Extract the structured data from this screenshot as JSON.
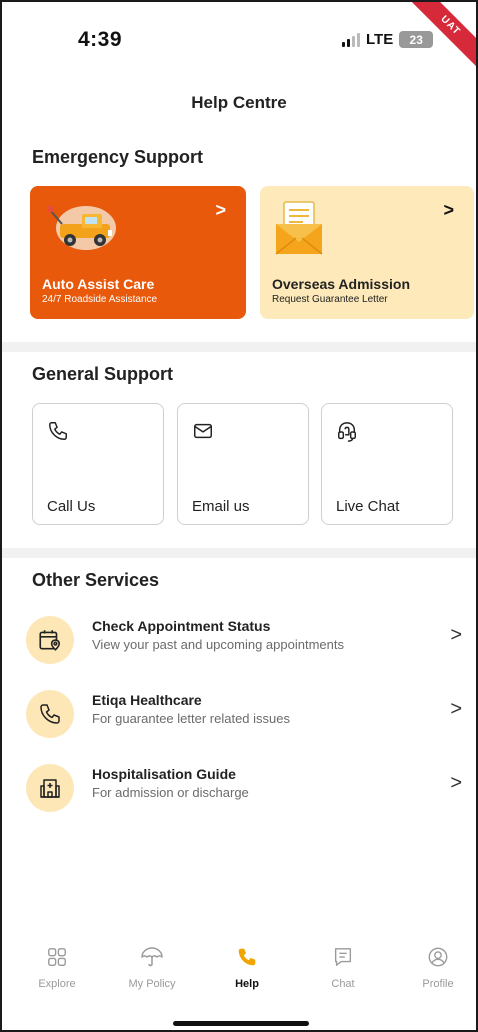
{
  "status": {
    "time": "4:39",
    "network": "LTE",
    "battery": "23",
    "env_badge": "UAT"
  },
  "header": {
    "title": "Help Centre"
  },
  "emergency": {
    "title": "Emergency Support",
    "cards": [
      {
        "title": "Auto Assist Care",
        "subtitle": "24/7 Roadside Assistance",
        "chevron": ">",
        "icon": "tow-truck-icon",
        "color": "#e8590c"
      },
      {
        "title": "Overseas Admission",
        "subtitle": "Request Guarantee Letter",
        "chevron": ">",
        "icon": "envelope-letter-icon",
        "color": "#fde9b9"
      }
    ]
  },
  "general": {
    "title": "General Support",
    "tiles": [
      {
        "label": "Call Us",
        "icon": "phone-icon"
      },
      {
        "label": "Email us",
        "icon": "mail-icon"
      },
      {
        "label": "Live Chat",
        "icon": "headset-icon"
      }
    ]
  },
  "other": {
    "title": "Other Services",
    "items": [
      {
        "title": "Check Appointment Status",
        "subtitle": "View your past and upcoming appointments",
        "icon": "calendar-location-icon",
        "chevron": ">"
      },
      {
        "title": "Etiqa Healthcare",
        "subtitle": "For guarantee letter related issues",
        "icon": "phone-icon",
        "chevron": ">"
      },
      {
        "title": "Hospitalisation Guide",
        "subtitle": "For admission or discharge",
        "icon": "hospital-icon",
        "chevron": ">"
      }
    ]
  },
  "nav": {
    "active": "Help",
    "accent": "#f0a500",
    "tabs": [
      {
        "label": "Explore",
        "icon": "grid-icon"
      },
      {
        "label": "My Policy",
        "icon": "umbrella-icon"
      },
      {
        "label": "Help",
        "icon": "phone-icon"
      },
      {
        "label": "Chat",
        "icon": "chat-icon"
      },
      {
        "label": "Profile",
        "icon": "profile-icon"
      }
    ]
  }
}
